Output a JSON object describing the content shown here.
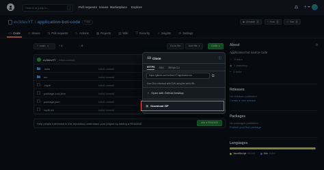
{
  "header": {
    "search_placeholder": "Search or jump to...",
    "slash": "/",
    "nav": [
      "Pull requests",
      "Issues",
      "Marketplace",
      "Explore"
    ]
  },
  "repo": {
    "owner": "ev3devYT",
    "separator": "/",
    "name": "application-bot-code",
    "visibility": "Public",
    "unwatch_label": "Unwatch",
    "unwatch_count": "1",
    "fork_label": "Fork",
    "fork_count": "0",
    "star_label": "Star",
    "star_count": "0"
  },
  "tabs": [
    {
      "label": "Code",
      "icon": "code-icon"
    },
    {
      "label": "Issues",
      "icon": "issue-icon"
    },
    {
      "label": "Pull requests",
      "icon": "pull-request-icon"
    },
    {
      "label": "Actions",
      "icon": "play-icon"
    },
    {
      "label": "Projects",
      "icon": "table-icon"
    },
    {
      "label": "Wiki",
      "icon": "book-icon"
    },
    {
      "label": "Security",
      "icon": "shield-icon"
    },
    {
      "label": "Insights",
      "icon": "graph-icon"
    },
    {
      "label": "Settings",
      "icon": "gear-icon"
    }
  ],
  "branch_bar": {
    "branch": "main",
    "branches_count": "1",
    "tags_count": "0",
    "goto_file": "Go to file",
    "add_file": "Add file",
    "code": "Code"
  },
  "commit": {
    "author": "ev3devYT",
    "message": "Initial commit"
  },
  "files": [
    {
      "name": ".data",
      "type": "folder",
      "message": "Initial commit"
    },
    {
      "name": "src",
      "type": "folder",
      "message": "Initial commit"
    },
    {
      "name": ".replit",
      "type": "file",
      "message": "Initial commit"
    },
    {
      "name": "package-lock.json",
      "type": "file",
      "message": "Initial commit"
    },
    {
      "name": "package.json",
      "type": "file",
      "message": "Initial commit"
    },
    {
      "name": "replit.nix",
      "type": "file",
      "message": "Initial commit"
    }
  ],
  "readme_banner": {
    "text": "Help people interested in this repository understand your project by adding a README.",
    "button": "Add a README"
  },
  "clone_dropdown": {
    "title": "Clone",
    "tabs": [
      "HTTPS",
      "SSH",
      "GitHub CLI"
    ],
    "url": "https://github.com/ev3devYT/application-bo",
    "hint": "Use Git or checkout with SVN using the web URL.",
    "desktop": "Open with GitHub Desktop",
    "download": "Download ZIP"
  },
  "about": {
    "title": "About",
    "description": "Application bot source code",
    "stars": "0 stars",
    "watching": "1 watching",
    "forks": "0 forks"
  },
  "releases": {
    "title": "Releases",
    "text": "No releases published",
    "link": "Create a new release"
  },
  "packages": {
    "title": "Packages",
    "text": "No packages published",
    "link": "Publish your first package"
  },
  "languages": {
    "title": "Languages",
    "items": [
      {
        "name": "JavaScript",
        "percent": "99.4%",
        "value": 99.4,
        "color": "#f1e05a"
      },
      {
        "name": "Nix",
        "percent": "0.6%",
        "value": 0.6,
        "color": "#7e7eff"
      }
    ]
  },
  "colors": {
    "accent_link": "#58a6ff",
    "green_button": "#238636",
    "highlight_border": "#f85149",
    "tab_underline": "#f78166"
  }
}
